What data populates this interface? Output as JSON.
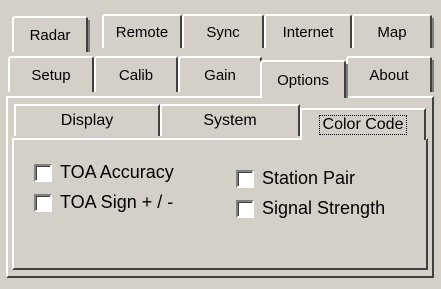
{
  "tabs_row1": [
    "Radar",
    "Remote",
    "Sync",
    "Internet",
    "Map"
  ],
  "tabs_row2": [
    "Setup",
    "Calib",
    "Gain",
    "Options",
    "About"
  ],
  "selected_tab": "Options",
  "subtabs": [
    "Display",
    "System",
    "Color Code"
  ],
  "selected_subtab": "Color Code",
  "checkboxes": {
    "toa_accuracy": {
      "label": "TOA Accuracy",
      "checked": false
    },
    "toa_sign": {
      "label": "TOA Sign + / -",
      "checked": false
    },
    "station_pair": {
      "label": "Station Pair",
      "checked": false
    },
    "signal_strength": {
      "label": "Signal Strength",
      "checked": false
    }
  }
}
